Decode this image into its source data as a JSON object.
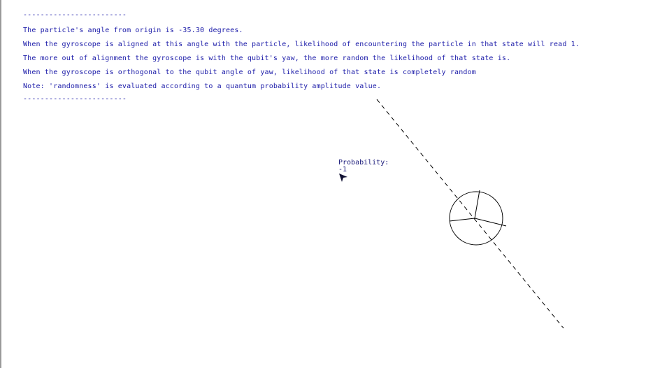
{
  "console": {
    "separator_top": "------------------------",
    "angle_line": "The particle's angle from origin is -35.30 degrees.",
    "aligned_line": "When the gyroscope is aligned at this angle with the particle, likelihood of encountering the particle in that state will read 1.",
    "misaligned_line": "The more out of alignment the gyroscope is with the qubit's yaw, the more random the likelihood of that state is.",
    "orthogonal_line": "When the gyroscope is orthogonal to the qubit angle of yaw, likelihood of that state is completely random",
    "note_line": "Note: 'randomness' is evaluated according to a quantum probability amplitude value.",
    "separator_bottom": "------------------------"
  },
  "probability": {
    "label": "Probability:",
    "value": "-1"
  },
  "scene": {
    "particle_angle_degrees": -35.3,
    "colors": {
      "text": "#1a1aa8",
      "lines": "#000000"
    },
    "icons": [
      "pointer-cursor-icon",
      "gyroscope-icon"
    ]
  }
}
